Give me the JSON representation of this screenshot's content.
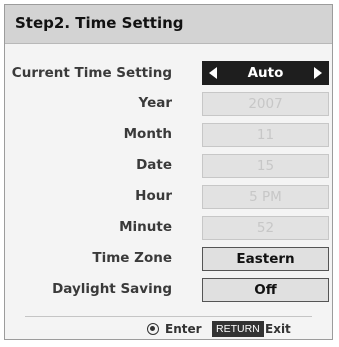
{
  "dialog": {
    "title": "Step2. Time Setting"
  },
  "settings": [
    {
      "label": "Current Time Setting",
      "value": "Auto",
      "state": "selected"
    },
    {
      "label": "Year",
      "value": "2007",
      "state": "disabled"
    },
    {
      "label": "Month",
      "value": "11",
      "state": "disabled"
    },
    {
      "label": "Date",
      "value": "15",
      "state": "disabled"
    },
    {
      "label": "Hour",
      "value": "5 PM",
      "state": "disabled"
    },
    {
      "label": "Minute",
      "value": "52",
      "state": "disabled"
    },
    {
      "label": "Time Zone",
      "value": "Eastern",
      "state": "enabled"
    },
    {
      "label": "Daylight Saving",
      "value": "Off",
      "state": "enabled"
    }
  ],
  "footer": {
    "enter_label": "Enter",
    "return_key": "RETURN",
    "exit_label": "Exit"
  },
  "icons": {
    "enter": "enter-circle-icon",
    "left_arrow": "arrow-left-icon",
    "right_arrow": "arrow-right-icon"
  },
  "colors": {
    "selected_bg": "#1e1e1e",
    "title_bar": "#d3d3d3",
    "disabled_text": "#c7c7c7"
  }
}
